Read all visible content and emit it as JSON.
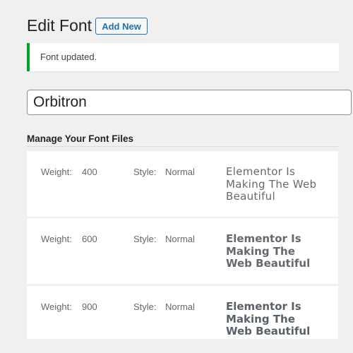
{
  "header": {
    "title": "Edit Font",
    "add_new_label": "Add New"
  },
  "notice": {
    "text": "Font updated.",
    "color": "#00a32a"
  },
  "font_name": {
    "value": "Orbitron"
  },
  "section": {
    "title": "Manage Your Font Files"
  },
  "font_files": [
    {
      "weight_label": "Weight:",
      "weight": "400",
      "style_label": "Style:",
      "style": "Normal",
      "preview": "Elementor Is Making The Web Beautiful"
    },
    {
      "weight_label": "Weight:",
      "weight": "600",
      "style_label": "Style:",
      "style": "Normal",
      "preview": "Elementor Is Making The Web Beautiful"
    },
    {
      "weight_label": "Weight:",
      "weight": "900",
      "style_label": "Style:",
      "style": "Normal",
      "preview": "Elementor Is Making The Web Beautiful"
    }
  ]
}
